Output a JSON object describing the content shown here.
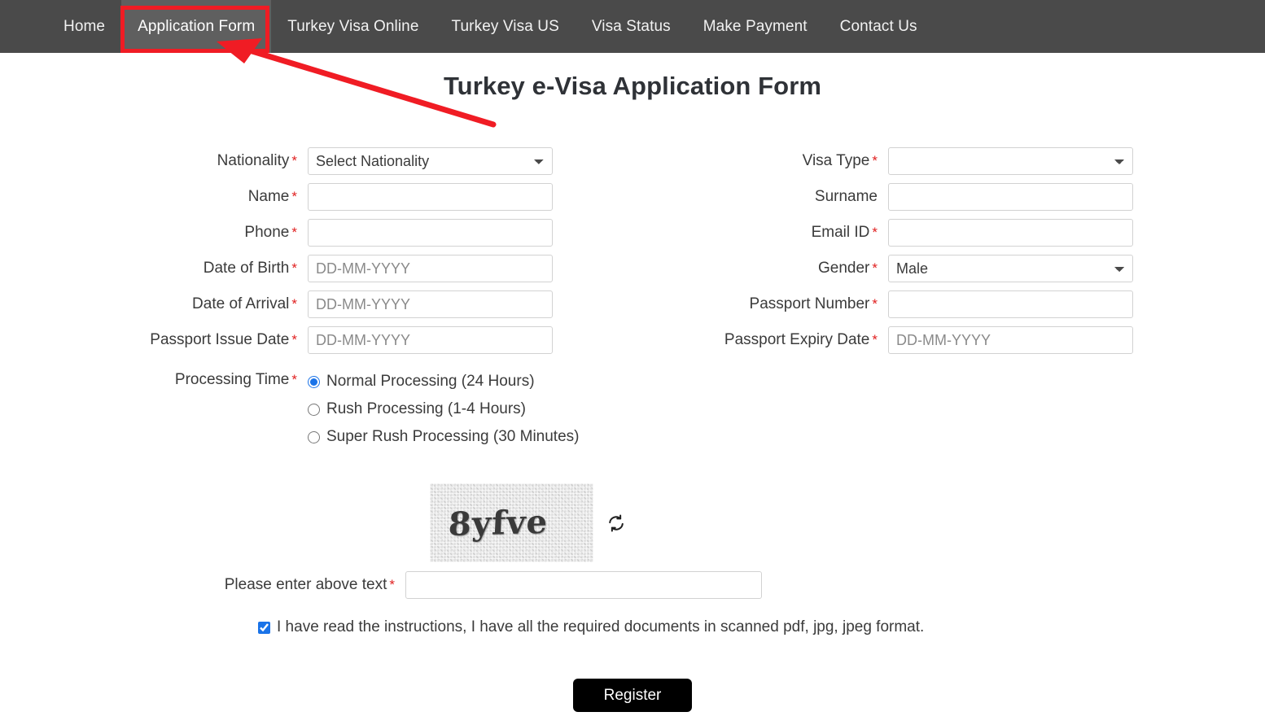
{
  "nav": {
    "items": [
      {
        "label": "Home",
        "active": false
      },
      {
        "label": "Application Form",
        "active": true
      },
      {
        "label": "Turkey Visa Online",
        "active": false
      },
      {
        "label": "Turkey Visa US",
        "active": false
      },
      {
        "label": "Visa Status",
        "active": false
      },
      {
        "label": "Make Payment",
        "active": false
      },
      {
        "label": "Contact Us",
        "active": false
      }
    ]
  },
  "page": {
    "title": "Turkey e-Visa Application Form"
  },
  "annotation": {
    "color": "#f01c24",
    "target": "Application Form"
  },
  "form": {
    "required_marker": "*",
    "left": [
      {
        "label": "Nationality",
        "required": true,
        "type": "select",
        "value": "Select Nationality",
        "placeholder": ""
      },
      {
        "label": "Name",
        "required": true,
        "type": "text",
        "value": "",
        "placeholder": ""
      },
      {
        "label": "Phone",
        "required": true,
        "type": "text",
        "value": "",
        "placeholder": ""
      },
      {
        "label": "Date of Birth",
        "required": true,
        "type": "text",
        "value": "",
        "placeholder": "DD-MM-YYYY"
      },
      {
        "label": "Date of Arrival",
        "required": true,
        "type": "text",
        "value": "",
        "placeholder": "DD-MM-YYYY"
      },
      {
        "label": "Passport Issue Date",
        "required": true,
        "type": "text",
        "value": "",
        "placeholder": "DD-MM-YYYY"
      }
    ],
    "right": [
      {
        "label": "Visa Type",
        "required": true,
        "type": "select",
        "value": "",
        "placeholder": ""
      },
      {
        "label": "Surname",
        "required": false,
        "type": "text",
        "value": "",
        "placeholder": ""
      },
      {
        "label": "Email ID",
        "required": true,
        "type": "text",
        "value": "",
        "placeholder": ""
      },
      {
        "label": "Gender",
        "required": true,
        "type": "select",
        "value": "Male",
        "placeholder": ""
      },
      {
        "label": "Passport Number",
        "required": true,
        "type": "text",
        "value": "",
        "placeholder": ""
      },
      {
        "label": "Passport Expiry Date",
        "required": true,
        "type": "text",
        "value": "",
        "placeholder": "DD-MM-YYYY"
      }
    ]
  },
  "processing": {
    "label": "Processing Time",
    "required": true,
    "selected": 0,
    "accent": "#1a73e8",
    "options": [
      {
        "label": "Normal Processing (24 Hours)"
      },
      {
        "label": "Rush Processing (1-4 Hours)"
      },
      {
        "label": "Super Rush Processing (30 Minutes)"
      }
    ]
  },
  "captcha": {
    "text": "8yfve",
    "refresh_icon": "refresh-icon",
    "input_label": "Please enter above text",
    "input_required": true,
    "input_value": "",
    "input_placeholder": ""
  },
  "agree": {
    "checked": true,
    "label": "I have read the instructions, I have all the required documents in scanned pdf, jpg, jpeg format."
  },
  "submit": {
    "label": "Register"
  }
}
